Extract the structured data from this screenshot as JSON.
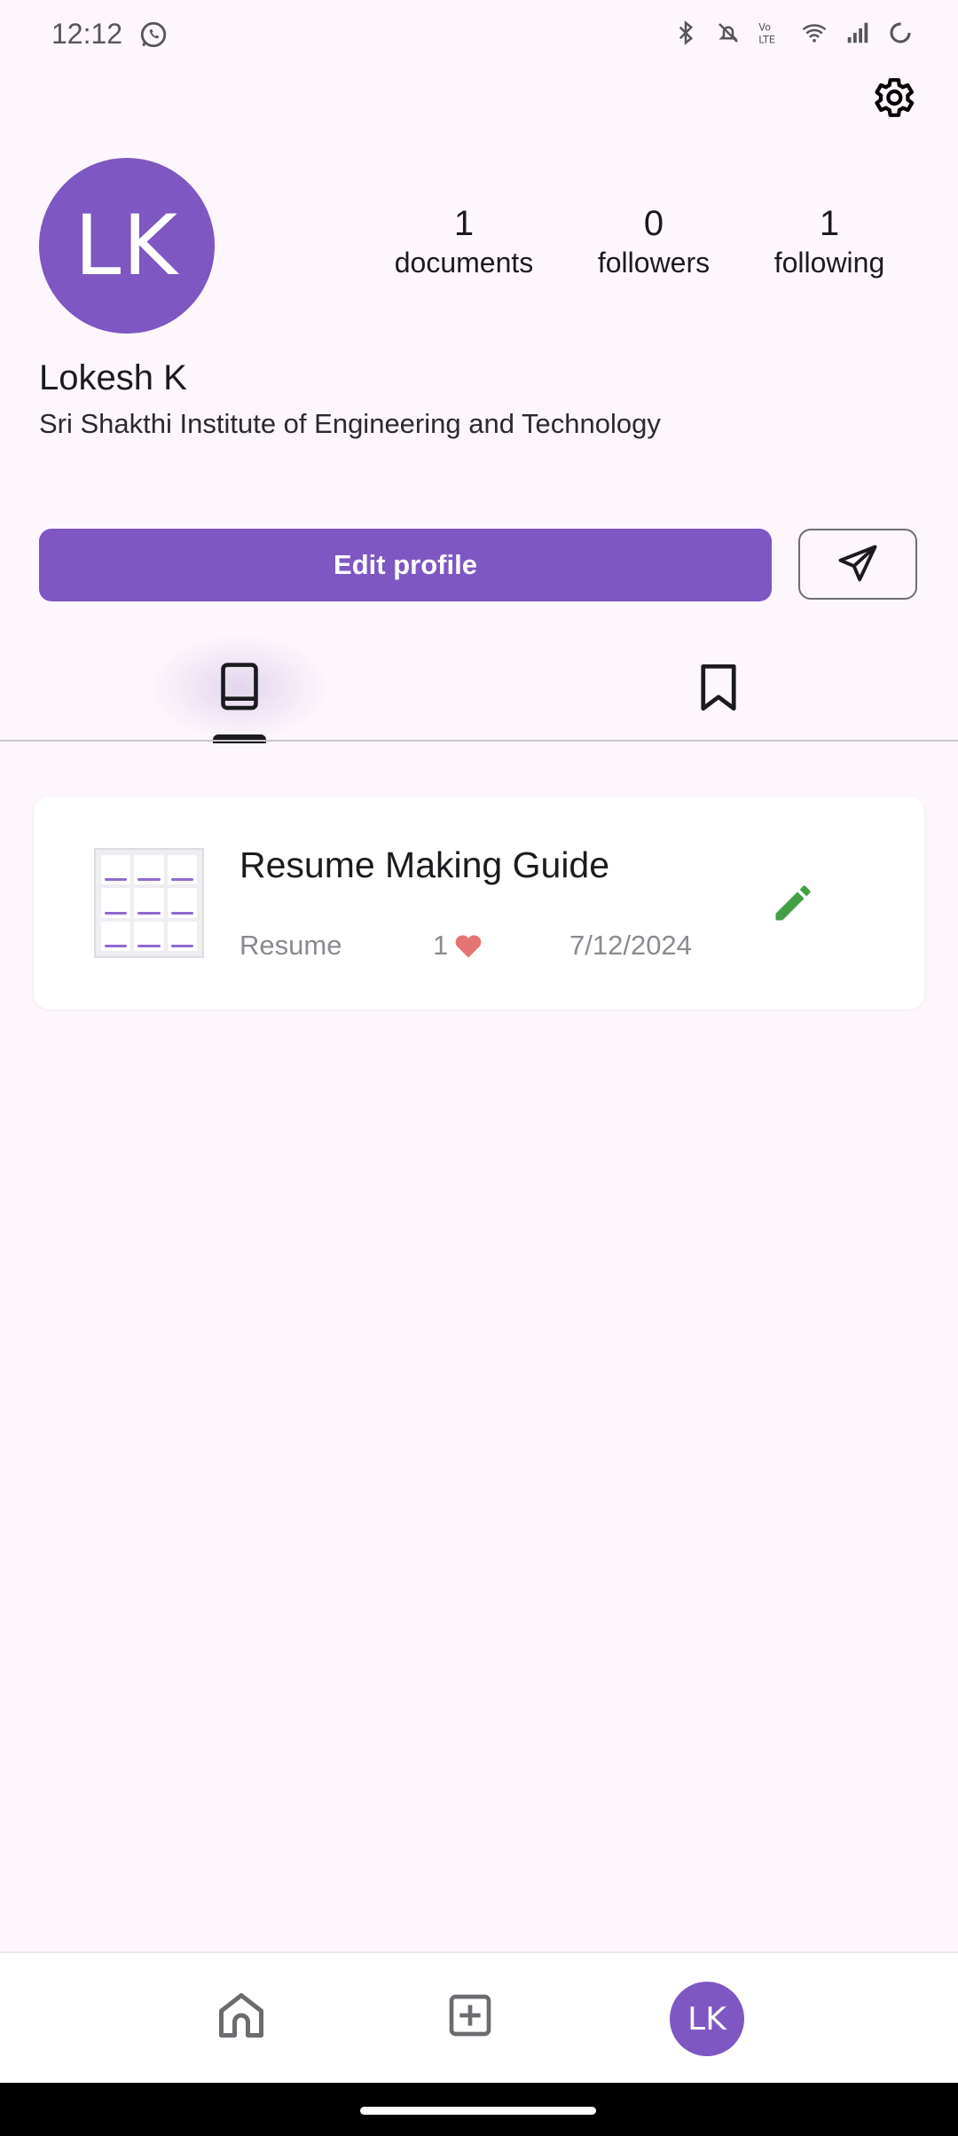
{
  "status_bar": {
    "time": "12:12"
  },
  "profile": {
    "avatar_initials": "LK",
    "name": "Lokesh K",
    "institute": "Sri Shakthi Institute of Engineering and Technology",
    "stats": {
      "documents": {
        "value": "1",
        "label": "documents"
      },
      "followers": {
        "value": "0",
        "label": "followers"
      },
      "following": {
        "value": "1",
        "label": "following"
      }
    },
    "edit_label": "Edit profile"
  },
  "tabs": [
    {
      "icon": "book-icon",
      "selected": true
    },
    {
      "icon": "bookmark-icon",
      "selected": false
    }
  ],
  "documents": [
    {
      "title": "Resume Making Guide",
      "category": "Resume",
      "likes": "1",
      "date": "7/12/2024"
    }
  ],
  "bottom_nav": {
    "items": [
      "home-icon",
      "add-box-icon",
      "profile-avatar"
    ],
    "avatar_initials": "LK"
  },
  "colors": {
    "accent": "#7e57c2",
    "background": "#fdf6fc",
    "like": "#e57373",
    "edit": "#43a047"
  }
}
